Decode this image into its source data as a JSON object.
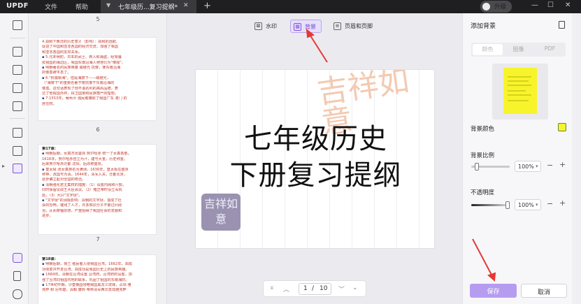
{
  "topbar": {
    "logo": "UPDF",
    "menu": [
      "文件",
      "帮助"
    ],
    "tab_title": "七年级历...复习提纲*",
    "upgrade": "升级"
  },
  "thumbnails": {
    "pages": [
      {
        "number": "5",
        "lines": [
          {
            "t": "4.郑和下西洋的历史意义（影响）：郑和的远航,",
            "c": "red"
          },
          {
            "t": "促进了中国和亚非各国的经济交流，加强了我国",
            "c": "red"
          },
          {
            "t": "和亚非各国的友好关系。",
            "c": "red"
          },
          {
            "t": "5.元末明初，日本的武士、商人和海盗，经常骚",
            "c": "red"
          },
          {
            "t": "扰我国的海边区，我国东南沿海人称他们为\"倭寇\"，",
            "c": "red"
          },
          {
            "t": "明朝著名的民族英雄 戚继光 抗倭，使东南沿海",
            "c": "red"
          },
          {
            "t": "的倭患被平息了。",
            "c": "red"
          },
          {
            "t": "6.\"封疆锁海\"。但是海禁下——威继光，",
            "c": "red"
          },
          {
            "t": "（\"海禁下\"的重要名著于楼抗倭于东南沿海的",
            "c": "red"
          },
          {
            "t": "倭患。这句话表现了他不追名利的高尚品德，表",
            "c": "red"
          },
          {
            "t": "达了他报国外终，捍卫国家和民族尊严的理想。",
            "c": "red"
          },
          {
            "t": "7.1553年，葡萄牙 强民者攫取了我国广东 澳门 的",
            "c": "red"
          },
          {
            "t": "居住权。",
            "c": "red"
          }
        ]
      },
      {
        "number": "6",
        "lines": [
          {
            "t": "第17课：",
            "c": "bold"
          },
          {
            "t": "明朝后期，女真杰出首领 努尔哈赤 统一了女真各部。",
            "c": "red"
          },
          {
            "t": "1616年，努尔哈赤自立为汗，建号大金，历史称金。",
            "c": "red"
          },
          {
            "t": "后来努尔哈赤迁都 沈阳，后改称盛京。",
            "c": "red"
          },
          {
            "t": "皇太极 改女真族名为满洲，1636年，皇太极在盛京",
            "c": "red"
          },
          {
            "t": "称帝，改国号为清，1644年，清军入关，迁都北京，",
            "c": "red"
          },
          {
            "t": "逐步确立起对全国的统治。",
            "c": "red"
          },
          {
            "t": "清朝强化君主集权的措施：（1）设置内阁和六部，",
            "c": "red"
          },
          {
            "t": "同时保留议政王大臣会议。（2）雍正帝时设立军机",
            "c": "red"
          },
          {
            "t": "处。（3）大兴\"文字狱\"。",
            "c": "red"
          },
          {
            "t": "\"文字狱\"的消极影响：清朝的文字狱，造成了社",
            "c": "red"
          },
          {
            "t": "会的恐怖，摧残了人才，许多知识分子不敢过问政",
            "c": "red"
          },
          {
            "t": "治，从而禁锢思想，严重阻碍了我国社会的发展和",
            "c": "red"
          },
          {
            "t": "进步。",
            "c": "red"
          }
        ]
      },
      {
        "number": "7",
        "lines": [
          {
            "t": "第18课：",
            "c": "bold"
          },
          {
            "t": "明朝后期，荷兰 殖民者入侵我国台湾。1662年，郑成",
            "c": "red"
          },
          {
            "t": "功收复并开发台湾，郑成功是我国历史上的民族英雄。",
            "c": "red"
          },
          {
            "t": "1684年，清朝在台湾设置 台湾府，台湾府的设置，加",
            "c": "red"
          },
          {
            "t": "强了台湾同祖国内地的联系，巩固了祖国的东南海防。",
            "c": "red"
          },
          {
            "t": "17世纪中期，沙皇俄国侵略我国黑龙江流域，占领 雅",
            "c": "red"
          },
          {
            "t": "克萨 和 尼布楚，清朝 康熙 帝命清军两次发动雅克萨",
            "c": "red"
          }
        ]
      }
    ]
  },
  "toolbar_modes": {
    "watermark": "水印",
    "background": "背景",
    "header_footer": "页眉和页脚"
  },
  "document": {
    "title_line1": "七年级历史",
    "title_line2": "下册复习提纲",
    "watermark_text": "吉祥如意",
    "seal_text": "吉祥如意"
  },
  "pager": {
    "current": "1",
    "separator": "/",
    "total": "10"
  },
  "panel": {
    "title": "添加背景",
    "source_tabs": [
      "颜色",
      "图像",
      "PDF"
    ],
    "bg_color_label": "背景颜色",
    "bg_color": "#f7f42c",
    "scale_label": "背景比例",
    "scale_value": "100%",
    "opacity_label": "不透明度",
    "opacity_value": "100%",
    "opacity_fraction": 1.0,
    "scale_fraction": 0.1,
    "save": "保存",
    "cancel": "取消"
  },
  "colors": {
    "accent": "#7b55d6",
    "save_button": "#b69cf0",
    "annotation_arrow": "#e53935"
  }
}
